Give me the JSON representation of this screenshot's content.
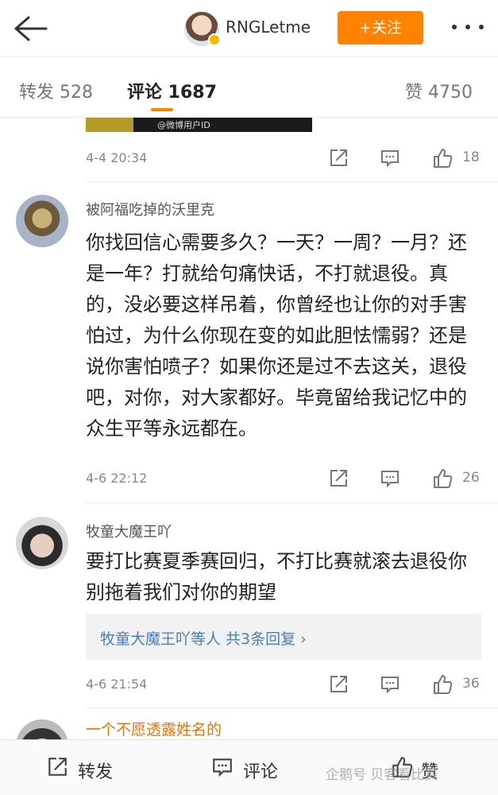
{
  "header": {
    "username": "RNGLetme",
    "follow_label": "+关注"
  },
  "tabs": [
    {
      "label": "转发 528"
    },
    {
      "label": "评论 1687"
    },
    {
      "label": "赞 4750"
    }
  ],
  "media": {
    "watermark": "@微博用户ID"
  },
  "comments": [
    {
      "time": "4-4 20:34",
      "likes": "18"
    },
    {
      "name": "被阿福吃掉的沃里克",
      "text": "你找回信心需要多久？一天？一周？一月？还是一年？打就给句痛快话，不打就退役。真的，没必要这样吊着，你曾经也让你的对手害怕过，为什么你现在变的如此胆怯懦弱？还是说你害怕喷子？如果你还是过不去这关，退役吧，对你，对大家都好。毕竟留给我记忆中的众生平等永远都在。",
      "time": "4-6 22:12",
      "likes": "26"
    },
    {
      "name": "牧童大魔王吖",
      "text": "要打比赛夏季赛回归，不打比赛就滚去退役你别拖着我们对你的期望",
      "replies": "牧童大魔王吖等人 共3条回复 ›",
      "time": "4-6 21:54",
      "likes": "36"
    },
    {
      "name": "一个不愿透露姓名的"
    }
  ],
  "bottom": {
    "repost": "转发",
    "comment": "评论",
    "like": "赞"
  },
  "watermark": "企鹅号 贝客看比赛",
  "icons": [
    "back-arrow-icon",
    "more-icon",
    "share-icon",
    "comment-icon",
    "like-icon"
  ],
  "colors": {
    "accent": "#ff8200",
    "link": "#4a7eb8",
    "peek_name": "#e8740c"
  }
}
